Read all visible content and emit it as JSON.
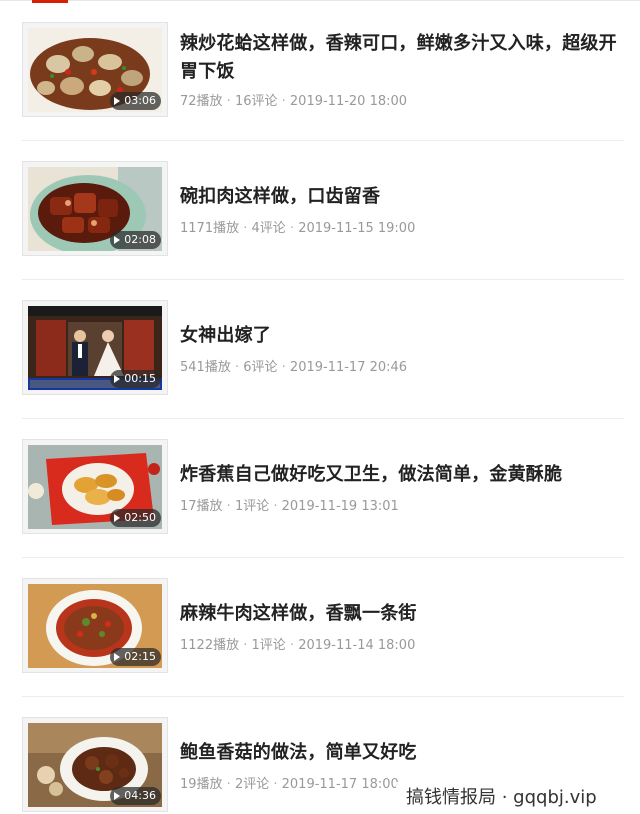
{
  "videos": [
    {
      "title": "辣炒花蛤这样做，香辣可口，鲜嫩多汁又入味，超级开胃下饭",
      "duration": "03:06",
      "plays": "72播放",
      "comments": "16评论",
      "datetime": "2019-11-20 18:00"
    },
    {
      "title": "碗扣肉这样做，口齿留香",
      "duration": "02:08",
      "plays": "1171播放",
      "comments": "4评论",
      "datetime": "2019-11-15 19:00"
    },
    {
      "title": "女神出嫁了",
      "duration": "00:15",
      "plays": "541播放",
      "comments": "6评论",
      "datetime": "2019-11-17 20:46"
    },
    {
      "title": "炸香蕉自己做好吃又卫生，做法简单，金黄酥脆",
      "duration": "02:50",
      "plays": "17播放",
      "comments": "1评论",
      "datetime": "2019-11-19 13:01"
    },
    {
      "title": "麻辣牛肉这样做，香飘一条街",
      "duration": "02:15",
      "plays": "1122播放",
      "comments": "1评论",
      "datetime": "2019-11-14 18:00"
    },
    {
      "title": "鲍鱼香菇的做法，简单又好吃",
      "duration": "04:36",
      "plays": "19播放",
      "comments": "2评论",
      "datetime": "2019-11-17 18:00"
    }
  ],
  "meta_separator": " · ",
  "watermark": "搞钱情报局 · gqqbj.vip",
  "colors": {
    "accent": "#d81e06",
    "title_text": "#222222",
    "meta_text": "#999999",
    "divider": "#ececec"
  }
}
